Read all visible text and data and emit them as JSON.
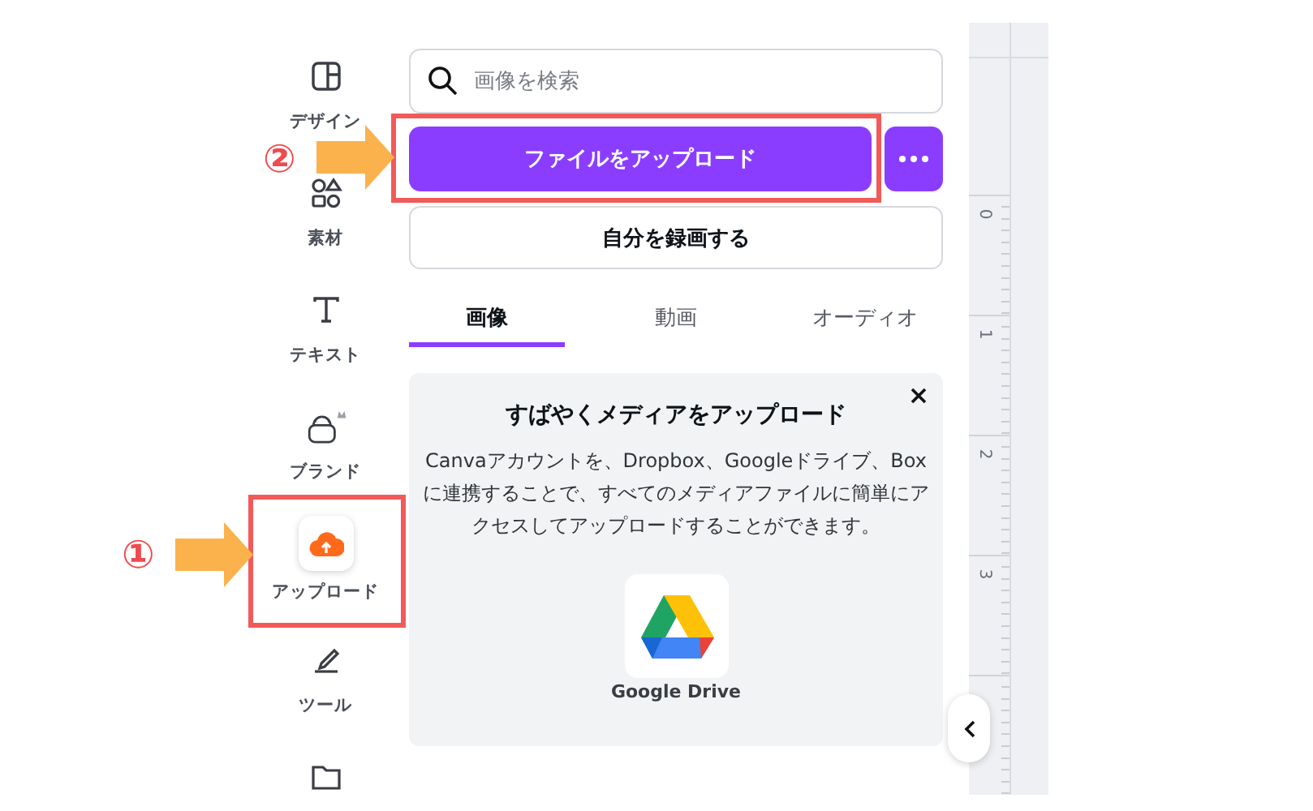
{
  "sidebar": {
    "items": [
      {
        "kind": "design",
        "label": "デザイン",
        "selected": false
      },
      {
        "kind": "elements",
        "label": "素材",
        "selected": false
      },
      {
        "kind": "text",
        "label": "テキスト",
        "selected": false
      },
      {
        "kind": "brand",
        "label": "ブランド",
        "selected": false
      },
      {
        "kind": "upload",
        "label": "アップロード",
        "selected": true
      },
      {
        "kind": "tools",
        "label": "ツール",
        "selected": false
      },
      {
        "kind": "folder",
        "selected": false
      }
    ]
  },
  "search": {
    "placeholder": "画像を検索"
  },
  "upload_button": "ファイルをアップロード",
  "record_button": "自分を録画する",
  "tabs": [
    {
      "label": "画像",
      "selected": true
    },
    {
      "label": "動画",
      "selected": false
    },
    {
      "label": "オーディオ",
      "selected": false
    }
  ],
  "promo": {
    "title": "すばやくメディアをアップロード",
    "body": "Canvaアカウントを、Dropbox、Googleドライブ、Boxに連携することで、すべてのメディアファイルに簡単にアクセスしてアップロードすることができます。",
    "app_label": "Google Drive"
  },
  "ruler": {
    "labels": [
      "0",
      "1",
      "2",
      "3"
    ]
  },
  "annotations": [
    {
      "number": "①"
    },
    {
      "number": "②"
    }
  ]
}
